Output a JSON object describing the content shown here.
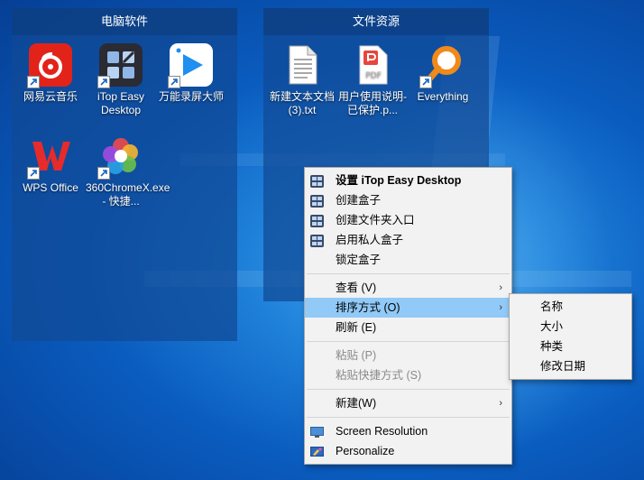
{
  "desktop": {
    "boxes": [
      {
        "title": "电脑软件",
        "icons": [
          {
            "label": "网易云音乐",
            "icon": "netease-music-icon"
          },
          {
            "label": "iTop Easy Desktop",
            "icon": "itop-easy-desktop-icon"
          },
          {
            "label": "万能录屏大师",
            "icon": "screen-recorder-icon"
          },
          {
            "label": "WPS Office",
            "icon": "wps-office-icon"
          },
          {
            "label": "360ChromeX.exe - 快捷...",
            "icon": "360-chrome-icon"
          }
        ]
      },
      {
        "title": "文件资源",
        "icons": [
          {
            "label": "新建文本文档 (3).txt",
            "icon": "text-file-icon"
          },
          {
            "label": "用户使用说明-已保护.p...",
            "icon": "pdf-file-icon"
          },
          {
            "label": "Everything",
            "icon": "everything-search-icon"
          }
        ]
      }
    ]
  },
  "context_menu": {
    "items": [
      {
        "label": "设置 iTop Easy Desktop",
        "icon": "itop-icon",
        "bold": true
      },
      {
        "label": "创建盒子",
        "icon": "itop-icon"
      },
      {
        "label": "创建文件夹入口",
        "icon": "itop-icon"
      },
      {
        "label": "启用私人盒子",
        "icon": "itop-icon"
      },
      {
        "label": "锁定盒子"
      },
      {
        "label": "查看 (V)",
        "submenu": true
      },
      {
        "label": "排序方式 (O)",
        "submenu": true,
        "highlighted": true
      },
      {
        "label": "刷新 (E)"
      },
      {
        "label": "粘贴 (P)",
        "disabled": true
      },
      {
        "label": "粘贴快捷方式 (S)",
        "disabled": true
      },
      {
        "label": "新建(W)",
        "submenu": true
      },
      {
        "label": "Screen Resolution",
        "icon": "monitor-icon"
      },
      {
        "label": "Personalize",
        "icon": "personalize-icon"
      }
    ],
    "arrow": "›"
  },
  "sort_submenu": {
    "items": [
      {
        "label": "名称"
      },
      {
        "label": "大小"
      },
      {
        "label": "种类"
      },
      {
        "label": "修改日期"
      }
    ]
  },
  "colors": {
    "menu_highlight": "#91c9f7",
    "box_bg": "#104a96"
  }
}
